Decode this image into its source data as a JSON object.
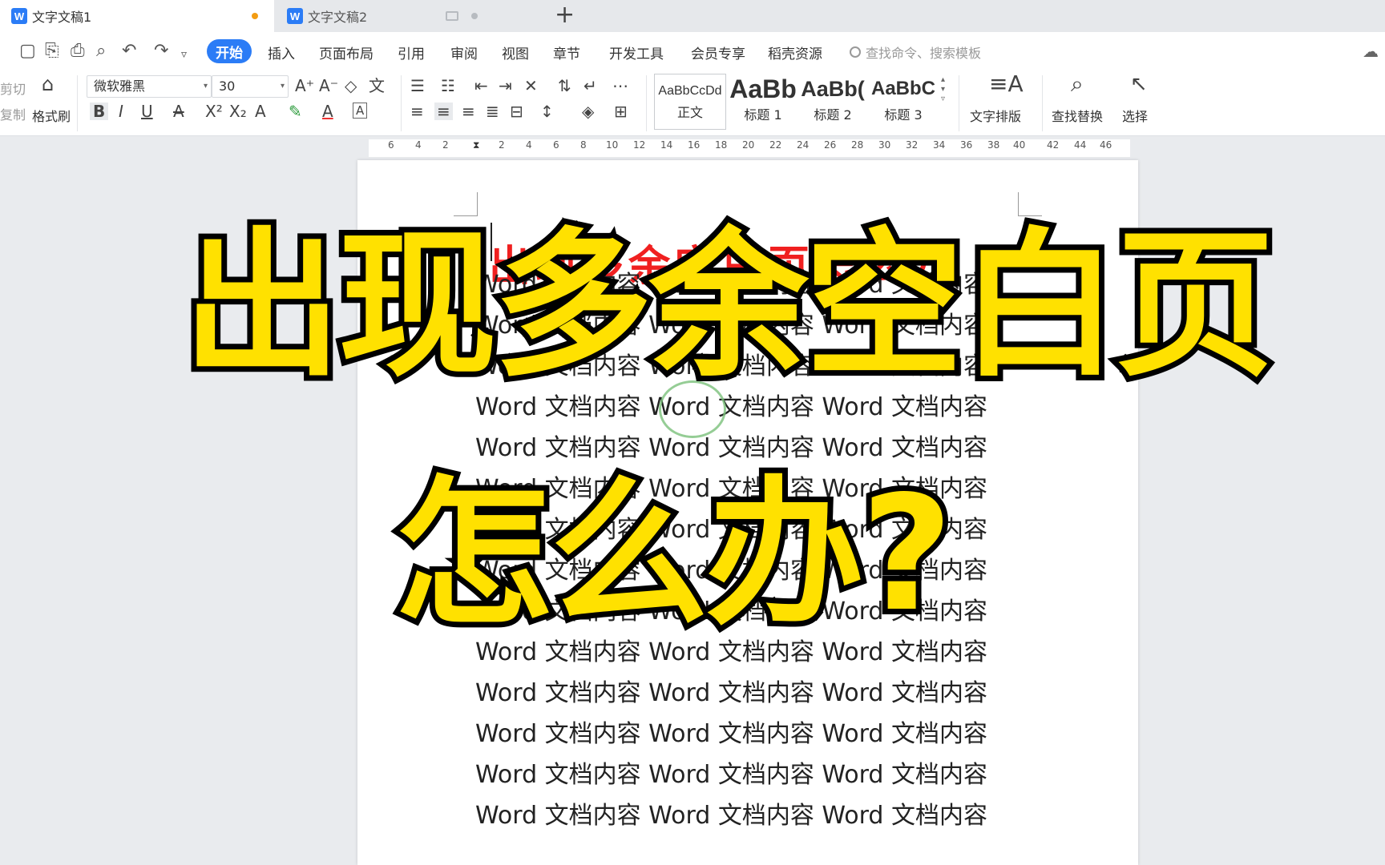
{
  "tabs": [
    {
      "icon": "W",
      "label": "文字文稿1"
    },
    {
      "icon": "W",
      "label": "文字文稿2"
    }
  ],
  "new_tab": "+",
  "menu": {
    "items": [
      "开始",
      "插入",
      "页面布局",
      "引用",
      "审阅",
      "视图",
      "章节",
      "开发工具",
      "会员专享",
      "稻壳资源"
    ],
    "search_placeholder": "查找命令、搜索模板"
  },
  "ribbon": {
    "cut": "剪切",
    "copy": "复制",
    "format_painter": "格式刷",
    "font_name": "微软雅黑",
    "font_size": "30",
    "styles": [
      {
        "sample": "AaBbCcDd",
        "name": "正文"
      },
      {
        "sample": "AaBb",
        "name": "标题 1"
      },
      {
        "sample": "AaBb(",
        "name": "标题 2"
      },
      {
        "sample": "AaBbC",
        "name": "标题 3"
      }
    ],
    "text_layout": "文字排版",
    "find_replace": "查找替换",
    "select": "选择"
  },
  "ruler": {
    "ticks": [
      "6",
      "4",
      "2",
      "2",
      "4",
      "6",
      "8",
      "10",
      "12",
      "14",
      "16",
      "18",
      "20",
      "22",
      "24",
      "26",
      "28",
      "30",
      "32",
      "34",
      "36",
      "38",
      "40",
      "42",
      "44",
      "46"
    ]
  },
  "document": {
    "heading": "出现多余空白页怎么办",
    "lines": [
      "Word 文档内容  Word 文档内容  Word 文档内容",
      "Word 文档内容  Word 文档内容  Word 文档内容",
      "Word 文档内容  Word 文档内容  Word 文档内容",
      "Word 文档内容  Word 文档内容  Word 文档内容",
      "Word 文档内容  Word 文档内容  Word 文档内容",
      "Word 文档内容  Word 文档内容  Word 文档内容",
      "Word 文档内容  Word 文档内容  Word 文档内容",
      "Word 文档内容  Word 文档内容  Word 文档内容",
      "Word 文档内容  Word 文档内容  Word 文档内容",
      "Word 文档内容  Word 文档内容  Word 文档内容",
      "Word 文档内容  Word 文档内容  Word 文档内容",
      "Word 文档内容  Word 文档内容  Word 文档内容",
      "Word 文档内容  Word 文档内容  Word 文档内容",
      "Word 文档内容  Word 文档内容  Word 文档内容"
    ]
  },
  "overlay": {
    "line1": "出现多余空白页",
    "line2": "怎么办?"
  },
  "colors": {
    "accent": "#2b7cf6",
    "overlay_fill": "#ffe100",
    "heading_red": "#f02020"
  }
}
